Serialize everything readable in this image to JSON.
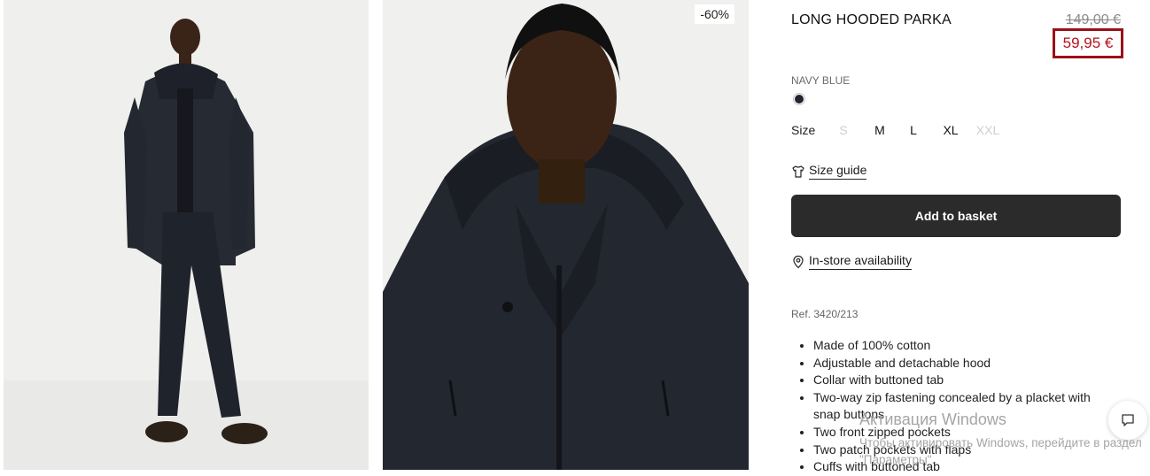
{
  "gallery": {
    "image1_alt": "Full-length model",
    "image2_alt": "Close-up model",
    "discount_badge": "-60%"
  },
  "product": {
    "title": "LONG HOODED PARKA",
    "old_price": "149,00 €",
    "new_price": "59,95 €",
    "color_name": "NAVY BLUE",
    "swatch_color": "#22252e",
    "size_label": "Size",
    "sizes": [
      {
        "label": "S",
        "available": false
      },
      {
        "label": "M",
        "available": true
      },
      {
        "label": "L",
        "available": true
      },
      {
        "label": "XL",
        "available": true
      },
      {
        "label": "XXL",
        "available": false
      }
    ],
    "size_guide": "Size guide",
    "add_to_basket": "Add to basket",
    "in_store": "In-store availability",
    "ref": "Ref. 3420/213",
    "features": [
      "Made of 100% cotton",
      "Adjustable and detachable hood",
      "Collar with buttoned tab",
      "Two-way zip fastening concealed by a placket with snap buttons",
      "Two front zipped pockets",
      "Two patch pockets with flaps",
      "Cuffs with buttoned tab"
    ]
  },
  "watermark": {
    "line1": "Активация Windows",
    "line2": "Чтобы активировать Windows, перейдите в раздел \"Параметры\"."
  },
  "colors": {
    "price_accent": "#b5121b",
    "price_border": "#9b0f1a",
    "button_bg": "#2b2b2b"
  }
}
